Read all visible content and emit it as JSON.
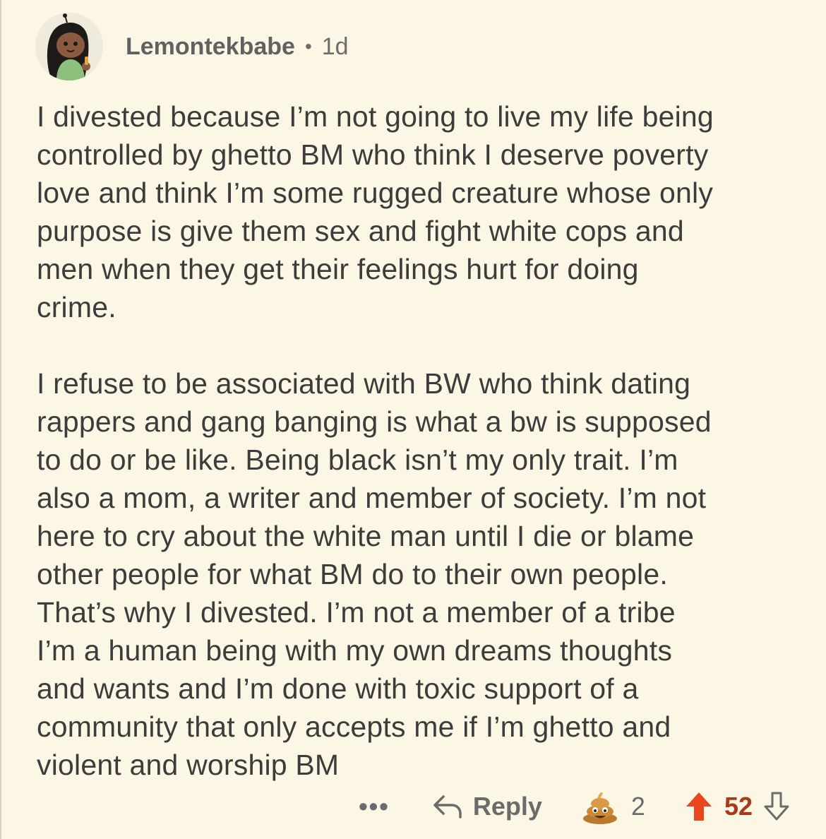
{
  "comment": {
    "author": "Lemontekbabe",
    "separator": "•",
    "age": "1d",
    "paragraphs": [
      "I divested because I’m not going to live my life being\ncontrolled by ghetto BM who think I deserve poverty\nlove and  think I’m some rugged creature whose only\npurpose is give them sex and fight white cops and\nmen when they get their feelings hurt for doing\ncrime.",
      "I refuse to be associated with BW who think dating\nrappers and gang banging is what a bw is supposed\nto do or be like. Being black isn’t my only trait. I’m\nalso a mom, a writer and member of society. I’m not\nhere to cry about the white man until I die or blame\nother people for what BM do to their own people.\nThat’s why I divested. I’m not a member of a tribe\nI’m a human being with my own dreams thoughts\nand wants and I’m done with toxic support of a\ncommunity that only accepts me if I’m ghetto and\nviolent and worship BM"
    ]
  },
  "actions": {
    "more": "•••",
    "reply_label": "Reply",
    "award_icon": "poop-emoji-icon",
    "award_count": "2",
    "vote_count": "52",
    "upvote_color": "#e8461c",
    "vote_count_color": "#a8391a"
  }
}
